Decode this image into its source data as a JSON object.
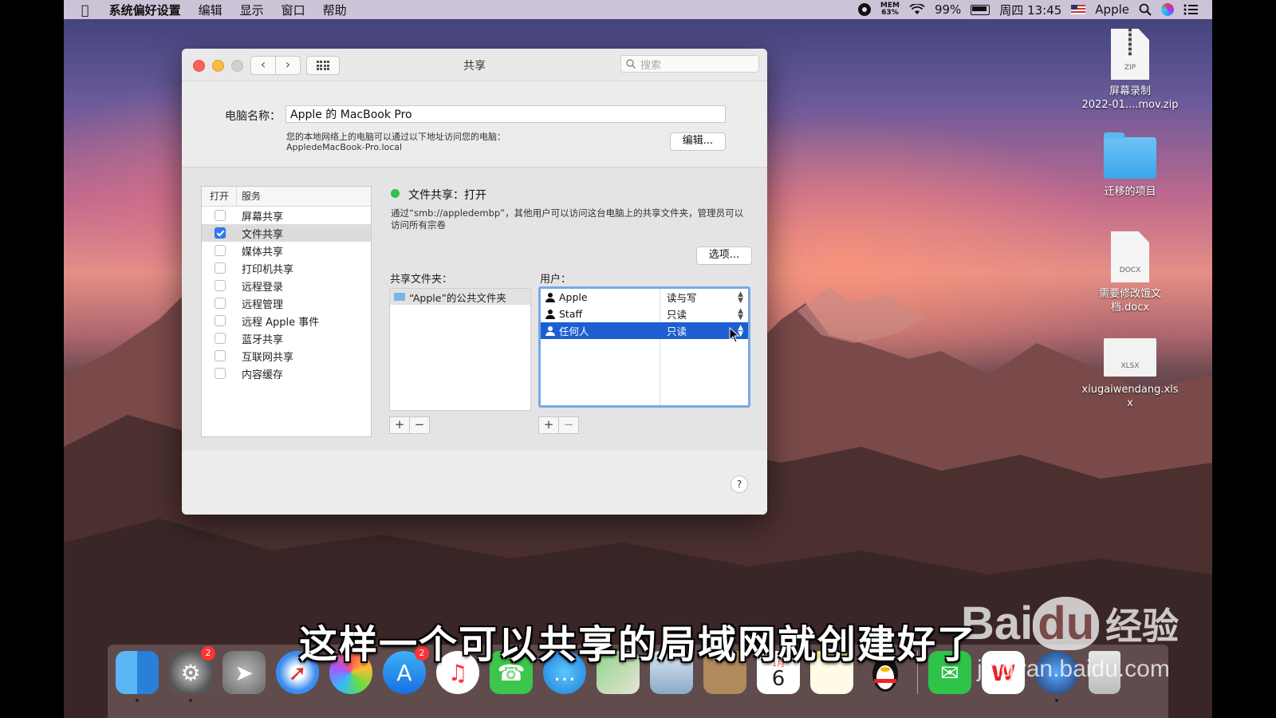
{
  "menubar": {
    "apple_icon": "apple-logo-icon",
    "app_name": "系统偏好设置",
    "menus": [
      "编辑",
      "显示",
      "窗口",
      "帮助"
    ],
    "mem_label": "MEM",
    "mem_value": "63%",
    "battery": "99%",
    "clock": "周四 13:45",
    "user": "Apple"
  },
  "window": {
    "title": "共享",
    "search_placeholder": "搜索",
    "computer_name_label": "电脑名称：",
    "computer_name": "Apple 的 MacBook Pro",
    "address_line1": "您的本地网络上的电脑可以通过以下地址访问您的电脑：",
    "address_line2": "AppledeMacBook-Pro.local",
    "edit_button": "编辑...",
    "services_header_on": "打开",
    "services_header_service": "服务",
    "services": [
      {
        "label": "屏幕共享",
        "checked": false
      },
      {
        "label": "文件共享",
        "checked": true
      },
      {
        "label": "媒体共享",
        "checked": false
      },
      {
        "label": "打印机共享",
        "checked": false
      },
      {
        "label": "远程登录",
        "checked": false
      },
      {
        "label": "远程管理",
        "checked": false
      },
      {
        "label": "远程 Apple 事件",
        "checked": false
      },
      {
        "label": "蓝牙共享",
        "checked": false
      },
      {
        "label": "互联网共享",
        "checked": false
      },
      {
        "label": "内容缓存",
        "checked": false
      }
    ],
    "status_text": "文件共享：打开",
    "status_color": "#2fbf4d",
    "description": "通过“smb://appledembp”，其他用户可以访问这台电脑上的共享文件夹，管理员可以访问所有宗卷",
    "options_button": "选项...",
    "shared_folders_label": "共享文件夹：",
    "shared_folders": [
      "“Apple”的公共文件夹"
    ],
    "users_label": "用户：",
    "users": [
      {
        "name": "Apple",
        "permission": "读与写"
      },
      {
        "name": "Staff",
        "permission": "只读"
      },
      {
        "name": "任何人",
        "permission": "只读"
      }
    ],
    "plus": "+",
    "minus": "−",
    "help": "?"
  },
  "desktop_icons": [
    {
      "line1": "屏幕录制",
      "line2": "2022-01....mov.zip",
      "ext": "ZIP"
    },
    {
      "line1": "迁移的项目"
    },
    {
      "line1": "需要修改饿文",
      "line2": "档.docx",
      "ext": "DOCX"
    },
    {
      "line1": "xiugaiwendang.xls",
      "line2": "x",
      "ext": "XLSX"
    }
  ],
  "dock": {
    "badge_prefs": "2",
    "badge_appstore": "2",
    "calendar_month": "1月",
    "calendar_day": "6"
  },
  "subtitle": "这样一个可以共享的局域网就创建好了",
  "watermark": {
    "brand": "Bai",
    "paw": "du",
    "cn": "经验",
    "url": "jingyan.baidu.com"
  }
}
